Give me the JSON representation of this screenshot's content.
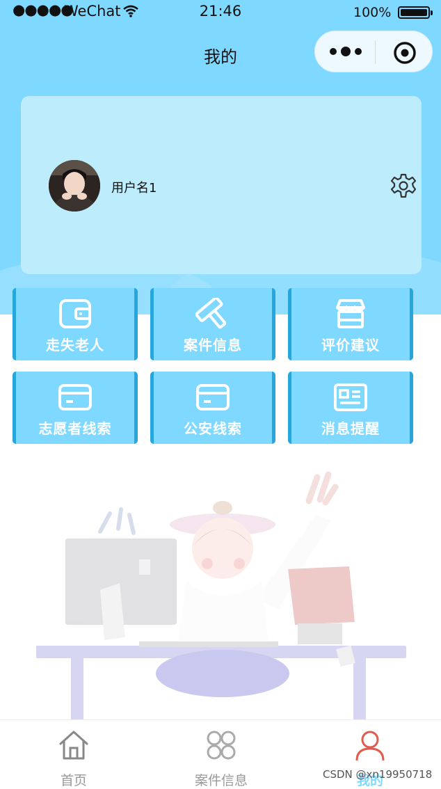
{
  "status_bar": {
    "signal": "●●●●●",
    "carrier": "WeChat",
    "time": "21:46",
    "battery": "100%"
  },
  "nav": {
    "title": "我的"
  },
  "profile": {
    "username": "用户名1"
  },
  "menu": [
    {
      "label": "走失老人",
      "icon": "wallet-icon"
    },
    {
      "label": "案件信息",
      "icon": "hammer-icon"
    },
    {
      "label": "评价建议",
      "icon": "store-icon"
    },
    {
      "label": "志愿者线索",
      "icon": "card-icon"
    },
    {
      "label": "公安线索",
      "icon": "card-icon"
    },
    {
      "label": "消息提醒",
      "icon": "id-card-icon"
    }
  ],
  "tabbar": {
    "tabs": [
      {
        "label": "首页",
        "icon": "home-icon",
        "active": false
      },
      {
        "label": "案件信息",
        "icon": "grid-icon",
        "active": false
      },
      {
        "label": "我的",
        "icon": "user-icon",
        "active": true
      }
    ]
  },
  "watermark": "CSDN @xn19950718",
  "colors": {
    "header_bg": "#7fd8ff",
    "card_bg": "#bdecfd",
    "menu_bg": "#7fd8ff",
    "menu_border": "#27a6dc",
    "active_tab_icon": "#e05a4e",
    "active_tab_label": "#7fd8ff"
  }
}
